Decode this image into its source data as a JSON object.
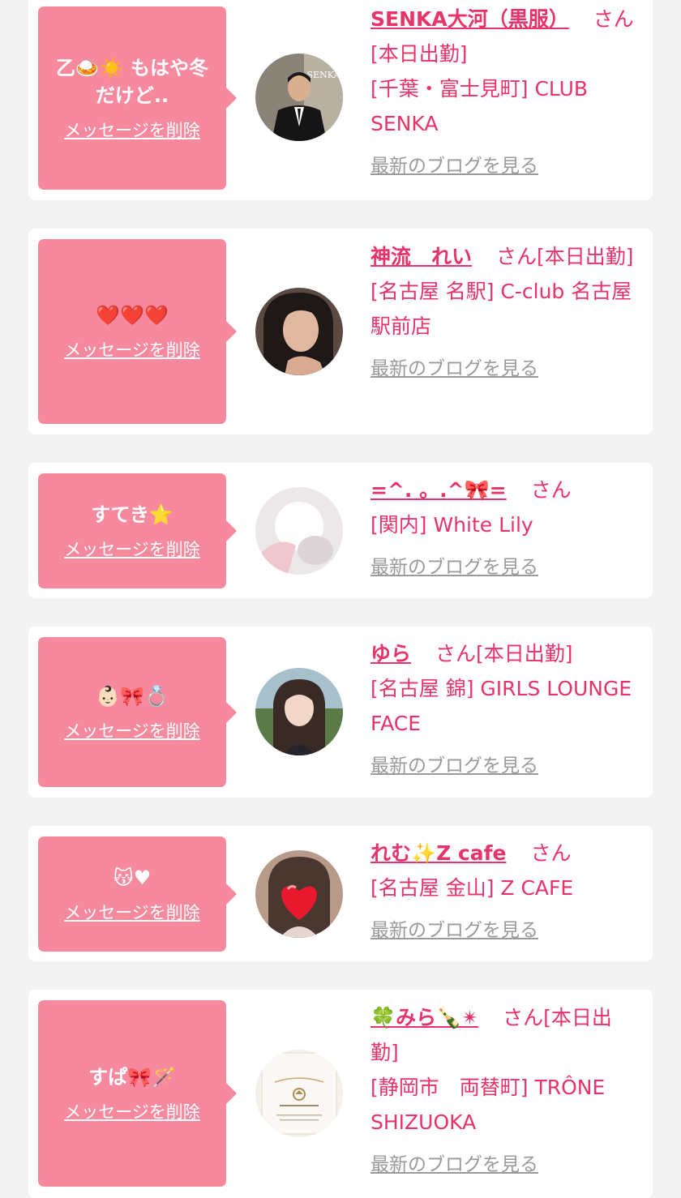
{
  "colors": {
    "accent": "#e8336a",
    "bubble": "#f7899f",
    "link_gray": "#9a9a9a"
  },
  "delete_label": "メッセージを削除",
  "blog_label": "最新のブログを見る",
  "entries": [
    {
      "message": "乙🍛☀️ もはや冬\nだけど..",
      "name": "SENKA大河（黒服）",
      "suffix": "さん[本日出勤]",
      "location": "[千葉・富士見町] CLUB SENKA",
      "avatar_icon": "man-in-suit-photo"
    },
    {
      "message": "❤️❤️❤️",
      "name": "神流　れい",
      "suffix": "さん[本日出勤]",
      "location": "[名古屋 名駅] C-club 名古屋駅前店",
      "avatar_icon": "woman-portrait-photo"
    },
    {
      "message": "すてき⭐️",
      "name": "=^. 。.^🎀=",
      "suffix": "さん",
      "location": "[関内] White Lily",
      "avatar_icon": "blurred-portrait-photo"
    },
    {
      "message": "👶🏻🎀💍",
      "name": "ゆら",
      "suffix": "さん[本日出勤]",
      "location": "[名古屋 錦] GIRLS LOUNGE FACE",
      "avatar_icon": "woman-outdoor-photo"
    },
    {
      "message": "😽♥",
      "name": "れむ✨Z cafe",
      "suffix": "さん",
      "location": "[名古屋 金山] Z CAFE",
      "avatar_icon": "heart-covered-portrait-photo"
    },
    {
      "message": "すぱ🎀🪄",
      "name": "🍀みら🍾✴",
      "suffix": "さん[本日出勤]",
      "location": "[静岡市　両替町] TRÔNE SHIZUOKA",
      "avatar_icon": "grand-open-trone-logo"
    }
  ]
}
